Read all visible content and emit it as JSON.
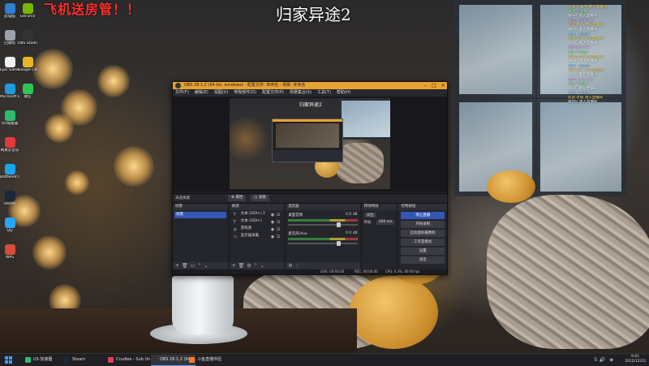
{
  "overlay": {
    "stream_title": "归家异途2",
    "promo": "飞机送房管！！"
  },
  "desktop_icons": [
    {
      "label": "此电脑",
      "color": "#2d7fd3"
    },
    {
      "label": "回收站",
      "color": "#9aa3ab"
    },
    {
      "label": "Epic Games Launcher",
      "color": "#f0f0f0"
    },
    {
      "label": "Microsoft Edge",
      "color": "#1e9be0"
    },
    {
      "label": "UU加速器",
      "color": "#2dbd6e"
    },
    {
      "label": "网易云音乐",
      "color": "#e23a3a"
    },
    {
      "label": "Battlenet Games",
      "color": "#1aa6ee"
    },
    {
      "label": "Steam",
      "color": "#1b2838"
    },
    {
      "label": "QQ",
      "color": "#27a6ff"
    },
    {
      "label": "WPS",
      "color": "#d84a3a"
    },
    {
      "label": "GeForce",
      "color": "#76b900"
    },
    {
      "label": "OBS Studio",
      "color": "#333333"
    },
    {
      "label": "Google Chrome",
      "color": "#e8b42a"
    },
    {
      "label": "微信",
      "color": "#2ec652"
    }
  ],
  "chat": [
    {
      "text": "欢迎 小猫咪 进入直播间",
      "color": "#ffe066"
    },
    {
      "text": "关注 了主播",
      "color": "#9dff9d"
    },
    {
      "text": "观众A 进入直播间",
      "color": "#ffffff"
    },
    {
      "text": "送出 小花花 x1",
      "color": "#ffb3ff"
    },
    {
      "text": "欢迎 路人 进入直播间",
      "color": "#ffe066"
    },
    {
      "text": "观众B 进入直播间",
      "color": "#ffffff"
    },
    {
      "text": "弹幕：主播好",
      "color": "#9dd6ff"
    },
    {
      "text": "欢迎 游客 进入直播间",
      "color": "#ffe066"
    },
    {
      "text": "观众C 进入直播间",
      "color": "#ffffff"
    },
    {
      "text": "送出 辣条 x3",
      "color": "#ffb3ff"
    },
    {
      "text": "关注 了主播",
      "color": "#9dff9d"
    },
    {
      "text": "欢迎 大佬 进入直播间",
      "color": "#ffe066"
    },
    {
      "text": "观众D 进入直播间",
      "color": "#ffffff"
    },
    {
      "text": "弹幕：哈哈哈",
      "color": "#9dd6ff"
    },
    {
      "text": "欢迎 新人 进入直播间",
      "color": "#ffe066"
    },
    {
      "text": "观众E 进入直播间",
      "color": "#ffffff"
    },
    {
      "text": "送出 小心心 x1",
      "color": "#ffb3ff"
    },
    {
      "text": "关注 了主播",
      "color": "#9dff9d"
    },
    {
      "text": "观众F 进入直播间",
      "color": "#ffffff"
    },
    {
      "text": "弹幕：冲冲冲",
      "color": "#9dd6ff"
    },
    {
      "text": "欢迎 老铁 进入直播间",
      "color": "#ffe066"
    },
    {
      "text": "观众G 进入直播间",
      "color": "#ffffff"
    }
  ],
  "obs": {
    "title": "OBS 28.1.2 (64-bit, windows) - 配置文件: 未命名 - 场景: 未命名",
    "menu": [
      "文件(F)",
      "编辑(E)",
      "视图(V)",
      "停靠部件(D)",
      "配置文件(P)",
      "场景集合(S)",
      "工具(T)",
      "帮助(H)"
    ],
    "preview_title": "归家异途2",
    "scene_bar": {
      "label": "未选择源",
      "properties": "属性",
      "filters": "滤镜"
    },
    "scenes": {
      "header": "场景",
      "items": [
        "场景"
      ]
    },
    "sources": {
      "header": "来源",
      "items": [
        {
          "label": "文本 (GDI+) 2",
          "icon": "text-icon"
        },
        {
          "label": "文本 (GDI+)",
          "icon": "text-icon"
        },
        {
          "label": "游戏源",
          "icon": "game-icon"
        },
        {
          "label": "显示器采集",
          "icon": "monitor-icon"
        }
      ]
    },
    "mixer": {
      "header": "混音器",
      "channels": [
        {
          "name": "桌面音频",
          "db": "0.0 dB",
          "level": 0.7
        },
        {
          "name": "麦克风/Aux",
          "db": "0.0 dB",
          "level": 0.7
        }
      ]
    },
    "transitions": {
      "header": "转场特效",
      "type": "淡出",
      "duration_label": "时长",
      "duration": "300 ms"
    },
    "controls": {
      "header": "控制按钮",
      "buttons": [
        "停止直播",
        "开始录制",
        "启动虚拟摄像机",
        "工作室模式",
        "设置",
        "退出"
      ]
    },
    "status": {
      "live": "LIVE: 00:00:00",
      "rec": "REC: 00:00:00",
      "cpu": "CPU: 0.3%, 60.00 fps"
    }
  },
  "taskbar": {
    "items": [
      {
        "label": "US·加速器",
        "color": "#2dbd6e",
        "active": false
      },
      {
        "label": "Steam",
        "color": "#1b2838",
        "active": false
      },
      {
        "label": "Crudlee - Sub Un...",
        "color": "#e33e54",
        "active": false
      },
      {
        "label": "OBS 28.1.2 (64-b...",
        "color": "#333333",
        "active": true
      },
      {
        "label": "斗鱼直播伴侣",
        "color": "#ff7a1a",
        "active": false
      }
    ],
    "time": "9:01",
    "date": "2022/12/22"
  }
}
